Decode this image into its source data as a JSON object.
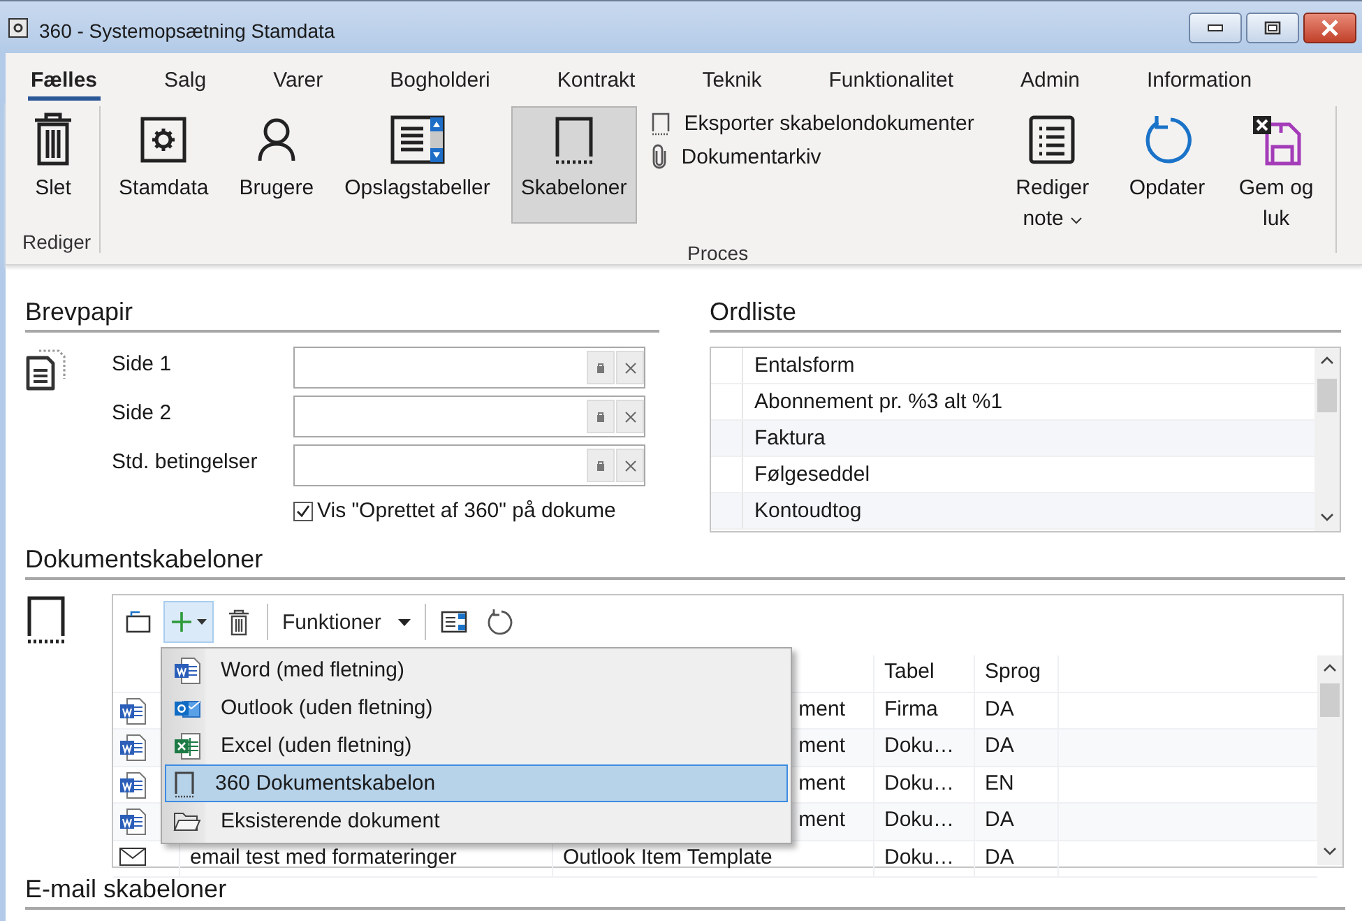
{
  "window": {
    "title": "360 - Systemopsætning Stamdata"
  },
  "tabs": [
    {
      "label": "Fælles",
      "selected": true
    },
    {
      "label": "Salg",
      "selected": false
    },
    {
      "label": "Varer",
      "selected": false
    },
    {
      "label": "Bogholderi",
      "selected": false
    },
    {
      "label": "Kontrakt",
      "selected": false
    },
    {
      "label": "Teknik",
      "selected": false
    },
    {
      "label": "Funktionalitet",
      "selected": false
    },
    {
      "label": "Admin",
      "selected": false
    },
    {
      "label": "Information",
      "selected": false
    }
  ],
  "ribbon": {
    "groups": [
      {
        "label": "Rediger",
        "buttons": [
          {
            "kind": "trash",
            "label": "Slet",
            "selected": false
          }
        ]
      },
      {
        "label": "Proces",
        "buttons": [
          {
            "kind": "settings",
            "label": "Stamdata",
            "selected": false
          },
          {
            "kind": "user",
            "label": "Brugere",
            "selected": false
          },
          {
            "kind": "lookup",
            "label": "Opslagstabeller",
            "selected": false
          },
          {
            "kind": "template",
            "label": "Skabeloner",
            "selected": true
          },
          {
            "kind": "stack",
            "items": [
              {
                "kind": "template",
                "label": "Eksporter skabelondokumenter"
              },
              {
                "kind": "paperclip",
                "label": "Dokumentarkiv"
              }
            ]
          },
          {
            "kind": "note",
            "label": "Rediger note",
            "selected": false
          },
          {
            "kind": "refresh",
            "label": "Opdater",
            "selected": false
          },
          {
            "kind": "save-close",
            "label": "Gem og luk",
            "selected": false
          }
        ]
      }
    ]
  },
  "brevpapir": {
    "title": "Brevpapir",
    "fields": [
      {
        "label": "Side 1"
      },
      {
        "label": "Side 2"
      },
      {
        "label": "Std. betingelser"
      }
    ],
    "checkbox": {
      "label": "Vis \"Oprettet af 360\" på dokume",
      "checked": true
    }
  },
  "ordliste": {
    "title": "Ordliste",
    "column_header": "Entalsform",
    "rows": [
      "Abonnement pr. %3 alt %1",
      "Faktura",
      "Følgeseddel",
      "Kontoudtog"
    ]
  },
  "dokumentskabeloner": {
    "title": "Dokumentskabeloner",
    "toolbar": [
      {
        "kind": "new",
        "selected": false
      },
      {
        "kind": "add",
        "selected": true
      },
      {
        "kind": "delete",
        "selected": false
      },
      {
        "kind": "separator"
      },
      {
        "kind": "dropdown",
        "label": "Funktioner"
      },
      {
        "kind": "separator"
      },
      {
        "kind": "columns",
        "selected": false
      },
      {
        "kind": "refresh",
        "selected": false
      }
    ],
    "columns": [
      "Tabel",
      "Sprog"
    ],
    "rows": [
      {
        "kind": "word",
        "type": "ment",
        "tabel": "Firma",
        "sprog": "DA"
      },
      {
        "kind": "word",
        "type": "ment",
        "tabel": "Doku…",
        "sprog": "DA"
      },
      {
        "kind": "word",
        "type": "ment",
        "tabel": "Doku…",
        "sprog": "EN"
      },
      {
        "kind": "word",
        "type": "ment",
        "tabel": "Doku…",
        "sprog": "DA"
      },
      {
        "kind": "mail",
        "name": "email test med formateringer",
        "type": "Outlook Item Template",
        "tabel": "Doku…",
        "sprog": "DA"
      }
    ],
    "menu": [
      {
        "kind": "word",
        "label": "Word (med fletning)",
        "selected": false
      },
      {
        "kind": "outlook",
        "label": "Outlook (uden fletning)",
        "selected": false
      },
      {
        "kind": "excel",
        "label": "Excel (uden fletning)",
        "selected": false
      },
      {
        "kind": "template",
        "label": "360 Dokumentskabelon",
        "selected": true
      },
      {
        "kind": "folder",
        "label": "Eksisterende dokument",
        "selected": false
      }
    ]
  },
  "email_skabeloner": {
    "title": "E-mail skabeloner"
  }
}
